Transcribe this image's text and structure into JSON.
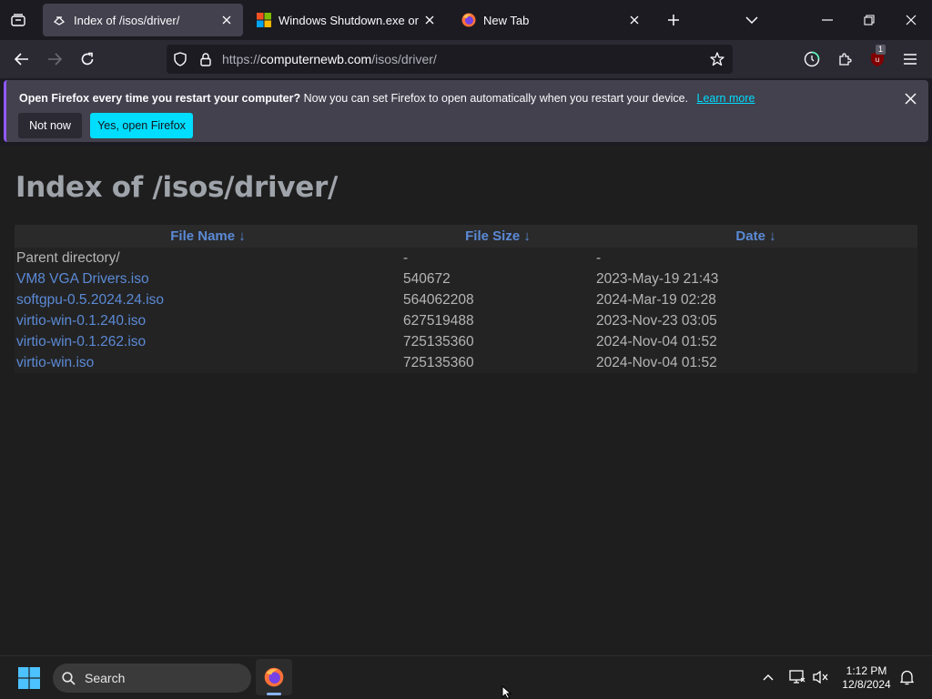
{
  "tabs": [
    {
      "title": "Index of /isos/driver/",
      "icon": "folder-drive-icon",
      "active": true
    },
    {
      "title": "Windows Shutdown.exe or shut",
      "icon": "windows-logo-icon",
      "active": false
    },
    {
      "title": "New Tab",
      "icon": "firefox-logo-icon",
      "active": false
    }
  ],
  "navbar": {
    "url_prefix": "https://",
    "url_host": "computernewb.com",
    "url_path": "/isos/driver/",
    "extension_badge": "1"
  },
  "notification": {
    "bold_text": "Open Firefox every time you restart your computer?",
    "text": "Now you can set Firefox to open automatically when you restart your device.",
    "link": "Learn more",
    "not_now": "Not now",
    "yes": "Yes, open Firefox"
  },
  "page": {
    "title": "Index of /isos/driver/",
    "columns": [
      "File Name  ↓",
      "File Size  ↓",
      "Date  ↓"
    ],
    "rows": [
      {
        "name": "Parent directory/",
        "size": "-",
        "date": "-"
      },
      {
        "name": "VM8 VGA Drivers.iso",
        "size": "540672",
        "date": "2023-May-19 21:43"
      },
      {
        "name": "softgpu-0.5.2024.24.iso",
        "size": "564062208",
        "date": "2024-Mar-19 02:28"
      },
      {
        "name": "virtio-win-0.1.240.iso",
        "size": "627519488",
        "date": "2023-Nov-23 03:05"
      },
      {
        "name": "virtio-win-0.1.262.iso",
        "size": "725135360",
        "date": "2024-Nov-04 01:52"
      },
      {
        "name": "virtio-win.iso",
        "size": "725135360",
        "date": "2024-Nov-04 01:52"
      }
    ]
  },
  "taskbar": {
    "search_label": "Search",
    "time": "1:12 PM",
    "date": "12/8/2024"
  },
  "colors": {
    "accent": "#00ddff",
    "link": "#5b8ad6",
    "title": "#9fa3aa"
  }
}
